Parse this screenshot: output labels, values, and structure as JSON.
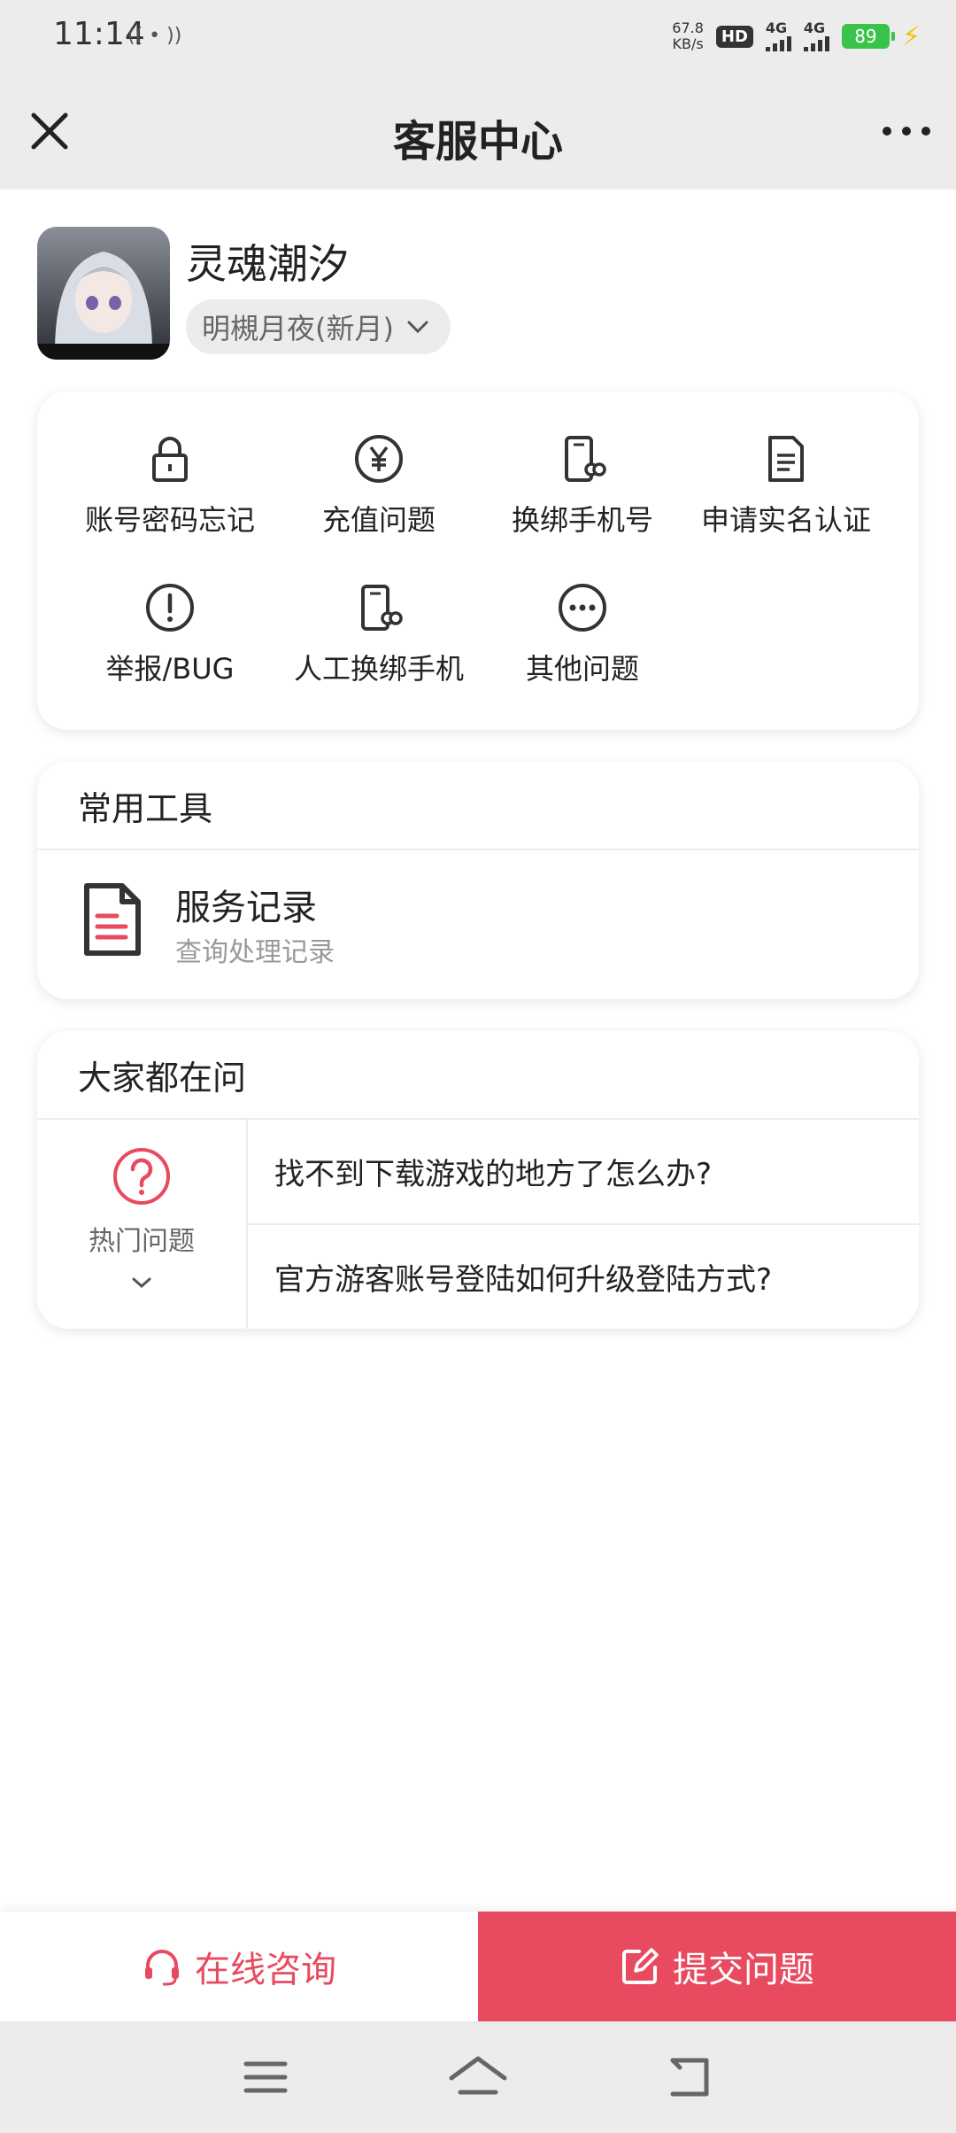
{
  "status_bar": {
    "time": "11:14",
    "cast_indicator": "(( • ))",
    "net_speed_value": "67.8",
    "net_speed_unit": "KB/s",
    "hd_label": "HD",
    "sim1_label": "4G",
    "sim2_label": "4G",
    "battery": "89",
    "charging_icon": "lightning-bolt-icon"
  },
  "header": {
    "title": "客服中心",
    "close_icon": "close-icon",
    "more_icon": "more-dots-icon"
  },
  "profile": {
    "username": "灵魂潮汐",
    "server": "明槻月夜(新月)"
  },
  "categories": [
    {
      "label": "账号密码忘记",
      "icon": "lock-icon"
    },
    {
      "label": "充值问题",
      "icon": "yuan-icon"
    },
    {
      "label": "换绑手机号",
      "icon": "phone-link-icon"
    },
    {
      "label": "申请实名认证",
      "icon": "document-icon"
    },
    {
      "label": "举报/BUG",
      "icon": "exclamation-icon"
    },
    {
      "label": "人工换绑手机",
      "icon": "phone-link-icon"
    },
    {
      "label": "其他问题",
      "icon": "more-circle-icon"
    }
  ],
  "tools": {
    "title": "常用工具",
    "items": [
      {
        "title": "服务记录",
        "subtitle": "查询处理记录",
        "icon": "record-document-icon"
      }
    ]
  },
  "faq": {
    "title": "大家都在问",
    "category_label": "热门问题",
    "questions": [
      "找不到下载游戏的地方了怎么办?",
      "官方游客账号登陆如何升级登陆方式?"
    ]
  },
  "actions": {
    "consult_label": "在线咨询",
    "submit_label": "提交问题"
  },
  "colors": {
    "accent": "#e84a5f",
    "background": "#ececec",
    "battery": "#3ac34a"
  }
}
